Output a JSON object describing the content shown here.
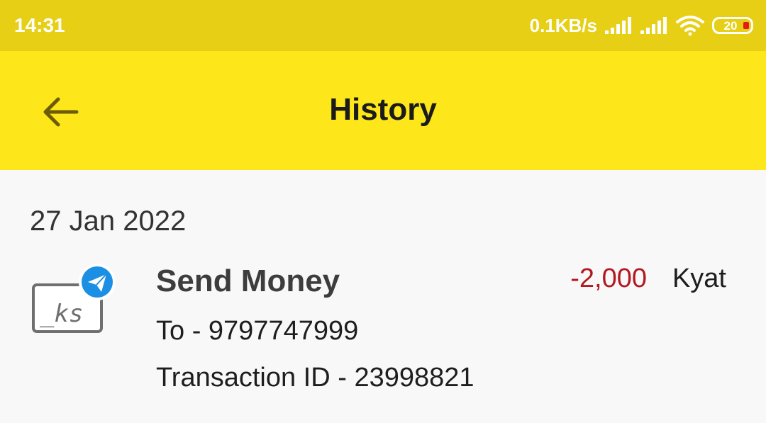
{
  "status_bar": {
    "time": "14:31",
    "net_speed": "0.1KB/s",
    "battery_level": "20",
    "colors": {
      "background": "#e6cf14",
      "battery_low": "#e41b1b"
    }
  },
  "app_bar": {
    "title": "History",
    "back_icon": "arrow-left-icon",
    "colors": {
      "background": "#fde619"
    }
  },
  "history": {
    "date": "27 Jan 2022",
    "transactions": [
      {
        "icon": "send-money-icon",
        "icon_text": "_ks",
        "type": "Send Money",
        "to": "To - 9797747999",
        "transaction_id": "Transaction ID - 23998821",
        "amount": "-2,000",
        "currency": "Kyat",
        "amount_color": "#b3171f"
      }
    ]
  }
}
